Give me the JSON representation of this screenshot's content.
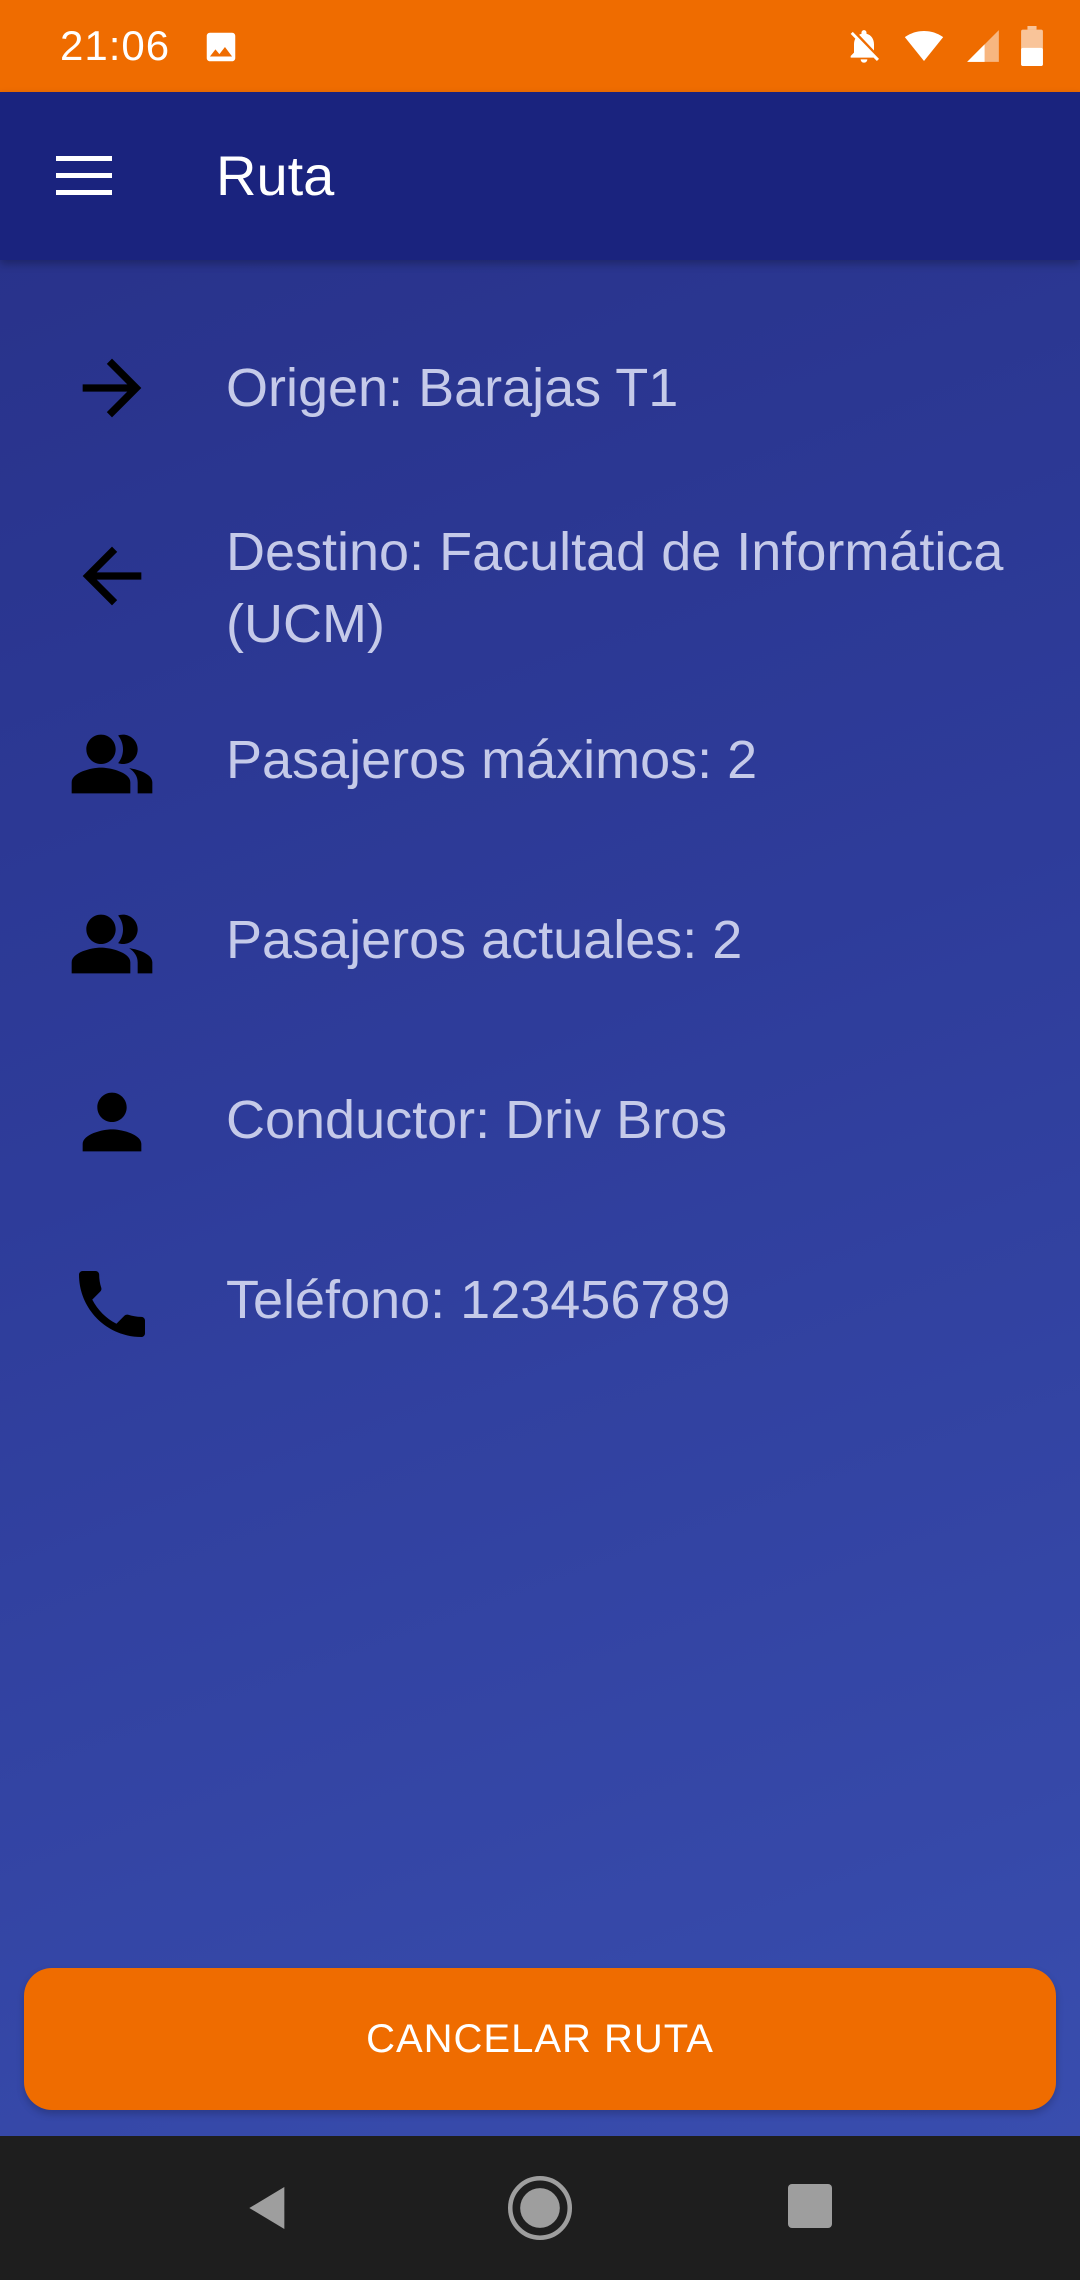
{
  "status_bar": {
    "time": "21:06",
    "icons": [
      "image-icon",
      "notifications-off-icon",
      "wifi-icon",
      "signal-icon",
      "battery-icon"
    ]
  },
  "app_bar": {
    "title": "Ruta",
    "menu_icon": "menu-icon"
  },
  "route_info": [
    {
      "icon": "arrow-right-icon",
      "text": "Origen:  Barajas T1"
    },
    {
      "icon": "arrow-left-icon",
      "text": "Destino: Facultad de Informática (UCM)"
    },
    {
      "icon": "people-icon",
      "text": "Pasajeros máximos: 2"
    },
    {
      "icon": "people-icon",
      "text": "Pasajeros actuales: 2"
    },
    {
      "icon": "person-icon",
      "text": "Conductor: Driv Bros"
    },
    {
      "icon": "phone-icon",
      "text": "Teléfono: 123456789"
    }
  ],
  "actions": {
    "cancel_label": "CANCELAR RUTA"
  },
  "nav_bar": {
    "buttons": [
      "back-icon",
      "home-icon",
      "recents-icon"
    ]
  },
  "colors": {
    "accent": "#ef6c00",
    "app_bar": "#1a237e",
    "background": "#2e3c9a",
    "text": "#c5cae9"
  }
}
